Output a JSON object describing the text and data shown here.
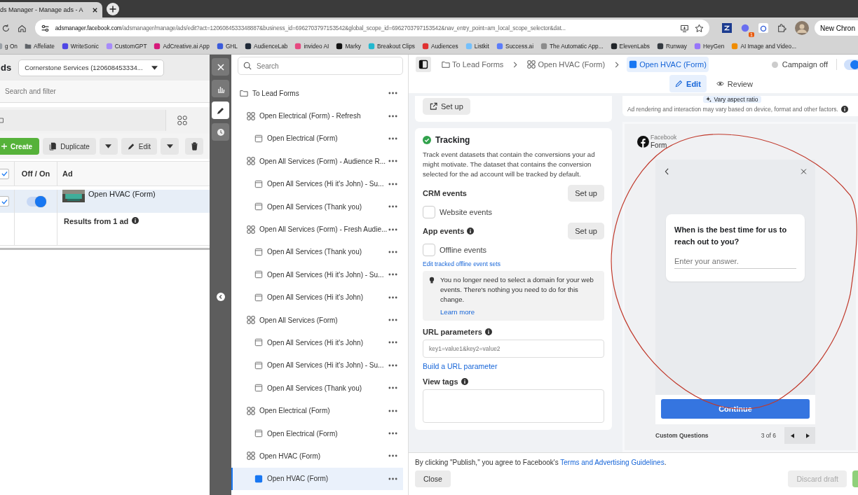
{
  "browser": {
    "tab_title": "ds Manager - Manage ads - A",
    "url_host": "adsmanager.facebook.com",
    "url_path": "/adsmanager/manage/ads/edit?act=1206084533348887&business_id=6962703797153542&global_scope_id=6962703797153542&nav_entry_point=am_local_scope_selector&dat...",
    "extension_badge": "1",
    "profile_button": "New Chron",
    "bookmarks": [
      {
        "label": "g On",
        "kind": "site",
        "color": "#9aa0a6"
      },
      {
        "label": "Affeliate",
        "kind": "folder",
        "color": "#5f6368"
      },
      {
        "label": "WriteSonic",
        "kind": "site",
        "color": "#4f46e5"
      },
      {
        "label": "CustomGPT",
        "kind": "site",
        "color": "#a78bfa"
      },
      {
        "label": "AdCreative.ai App",
        "kind": "site",
        "color": "#d6197a"
      },
      {
        "label": "GHL",
        "kind": "site",
        "color": "#3b5bdb"
      },
      {
        "label": "AudienceLab",
        "kind": "site",
        "color": "#1f2937"
      },
      {
        "label": "invideo AI",
        "kind": "site",
        "color": "#e64980"
      },
      {
        "label": "Marky",
        "kind": "site",
        "color": "#111111"
      },
      {
        "label": "Breakout Clips",
        "kind": "site",
        "color": "#22b8cf"
      },
      {
        "label": "Audiences",
        "kind": "site",
        "color": "#e03131"
      },
      {
        "label": "Listkit",
        "kind": "site",
        "color": "#74c0fc"
      },
      {
        "label": "Success.ai",
        "kind": "site",
        "color": "#5c7cfa"
      },
      {
        "label": "The Automatic App...",
        "kind": "site",
        "color": "#8c8c8c"
      },
      {
        "label": "ElevenLabs",
        "kind": "site",
        "color": "#212529"
      },
      {
        "label": "Runway",
        "kind": "site",
        "color": "#343a40"
      },
      {
        "label": "HeyGen",
        "kind": "site",
        "color": "#9775fa"
      },
      {
        "label": "AI Image and Video...",
        "kind": "site",
        "color": "#f08c00"
      }
    ]
  },
  "ads_panel": {
    "title": "ds",
    "account": "Cornerstone Services (120608453334...",
    "search": {
      "placeholder": "Search and filter"
    },
    "toolbar": {
      "create": "Create",
      "duplicate": "Duplicate",
      "edit": "Edit"
    },
    "select_all_checked": true,
    "columns": [
      "Off / On",
      "Ad"
    ],
    "rows": [
      {
        "checked": true,
        "on": true,
        "name": "Open HVAC (Form)",
        "selected": true
      }
    ],
    "results": "Results from 1 ad"
  },
  "rail": [
    {
      "kind": "close",
      "selected": false
    },
    {
      "kind": "chart",
      "selected": false
    },
    {
      "kind": "edit",
      "selected": true
    },
    {
      "kind": "history",
      "selected": false
    }
  ],
  "tree": {
    "search": {
      "placeholder": "Search"
    },
    "root": {
      "kind": "folder",
      "label": "To Lead Forms",
      "selected": false,
      "children": [
        {
          "kind": "adset",
          "label": "Open Electrical (Form) - Refresh",
          "selected": false,
          "children": [
            {
              "kind": "ad",
              "label": "Open Electrical (Form)",
              "selected": false
            }
          ]
        },
        {
          "kind": "adset",
          "label": "Open All Services (Form) - Audience R...",
          "selected": false,
          "children": [
            {
              "kind": "ad",
              "label": "Open All Services (Hi it's John) - Su...",
              "selected": false
            },
            {
              "kind": "ad",
              "label": "Open All Services (Thank you)",
              "selected": false
            }
          ]
        },
        {
          "kind": "adset",
          "label": "Open All Services (Form) - Fresh Audie...",
          "selected": false,
          "children": [
            {
              "kind": "ad",
              "label": "Open All Services (Thank you)",
              "selected": false
            },
            {
              "kind": "ad",
              "label": "Open All Services (Hi it's John) - Su...",
              "selected": false
            },
            {
              "kind": "ad",
              "label": "Open All Services (Hi it's John)",
              "selected": false
            }
          ]
        },
        {
          "kind": "adset",
          "label": "Open All Services (Form)",
          "selected": false,
          "children": [
            {
              "kind": "ad",
              "label": "Open All Services (Hi it's John)",
              "selected": false
            },
            {
              "kind": "ad",
              "label": "Open All Services (Hi it's John) - Su...",
              "selected": false
            },
            {
              "kind": "ad",
              "label": "Open All Services (Thank you)",
              "selected": false
            }
          ]
        },
        {
          "kind": "adset",
          "label": "Open Electrical (Form)",
          "selected": false,
          "children": [
            {
              "kind": "ad",
              "label": "Open Electrical (Form)",
              "selected": false
            }
          ]
        },
        {
          "kind": "adset",
          "label": "Open HVAC (Form)",
          "selected": false,
          "children": [
            {
              "kind": "ad",
              "label": "Open HVAC (Form)",
              "selected": true
            }
          ]
        }
      ]
    }
  },
  "header": {
    "breadcrumbs": [
      {
        "kind": "folder",
        "label": "To Lead Forms",
        "selected": false
      },
      {
        "kind": "adset",
        "label": "Open HVAC (Form)",
        "selected": false
      },
      {
        "kind": "ad",
        "label": "Open HVAC (Form)",
        "selected": true
      }
    ],
    "campaign_status": "Campaign off",
    "campaign_on": true,
    "modes": [
      {
        "kind": "edit",
        "label": "Edit",
        "selected": true
      },
      {
        "kind": "review",
        "label": "Review",
        "selected": false
      }
    ]
  },
  "editor": {
    "setup_button": "Set up",
    "tracking": {
      "title": "Tracking",
      "complete": true,
      "description": "Track event datasets that contain the conversions your ad might motivate. The dataset that contains the conversion selected for the ad account will be tracked by default.",
      "crm_label": "CRM events",
      "crm_button": "Set up",
      "website_events": {
        "label": "Website events",
        "checked": false
      },
      "app_label": "App events",
      "app_button": "Set up",
      "offline_events": {
        "label": "Offline events",
        "checked": false
      },
      "offline_link": "Edit tracked offline event sets",
      "note": "You no longer need to select a domain for your web events. There's nothing you need to do for this change.",
      "note_link": "Learn more",
      "url_label": "URL parameters",
      "url_placeholder": "key1=value1&key2=value2",
      "url_link": "Build a URL parameter",
      "tags_label": "View tags"
    }
  },
  "preview": {
    "aspect_chip": "Vary aspect ratio",
    "notice": "Ad rendering and interaction may vary based on device, format and other factors.",
    "platform": "Facebook",
    "format": "Form",
    "question": "When is the best time for us to reach out to you?",
    "answer_placeholder": "Enter your answer.",
    "continue": "Continue",
    "section": "Custom Questions",
    "pager": "3 of 6"
  },
  "footer": {
    "terms_prefix": "By clicking \"Publish,\" you agree to Facebook's ",
    "terms_link": "Terms and Advertising Guidelines",
    "terms_suffix": ".",
    "close": "Close",
    "discard": "Discard draft",
    "discard_disabled": true
  }
}
